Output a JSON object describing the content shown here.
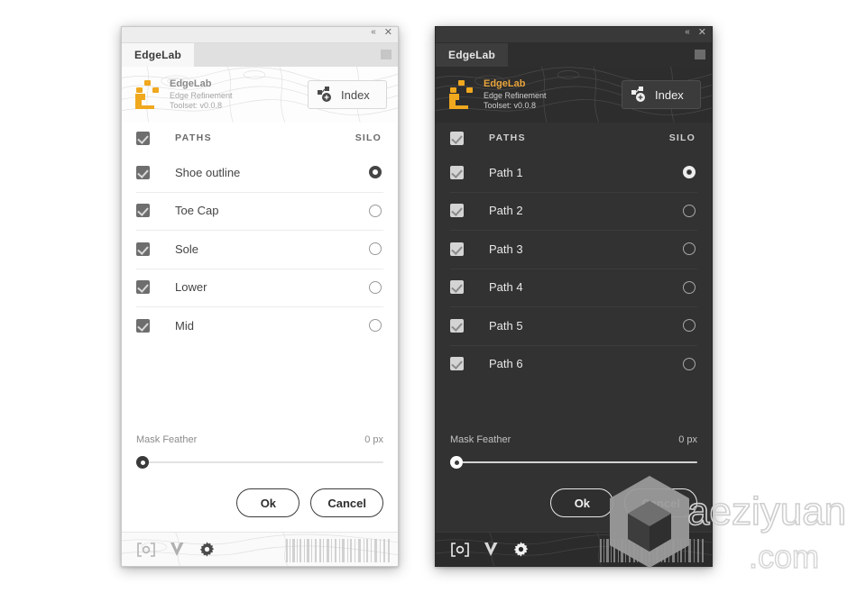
{
  "window": {
    "collapse_label": "«",
    "close_label": "✕"
  },
  "theme": {
    "accent_orange": "#f0a81e",
    "dark_bg": "#323232",
    "dark_panel_header": "#2d2d2d",
    "light_bg": "#ffffff",
    "light_header": "#ededed"
  },
  "panels": [
    {
      "variant": "light",
      "tab_label": "EdgeLab",
      "brand": {
        "title": "EdgeLab",
        "line1": "Edge Refinement",
        "line2": "Toolset: v0.0.8",
        "logo_icon": "edgelab-blocks-icon"
      },
      "index_button": {
        "label": "Index",
        "icon": "add-nodes-icon"
      },
      "list_header": {
        "checkbox_checked": true,
        "left_label": "PATHS",
        "right_label": "SILO"
      },
      "rows": [
        {
          "label": "Shoe outline",
          "checked": true,
          "silo": true
        },
        {
          "label": "Toe Cap",
          "checked": true,
          "silo": false
        },
        {
          "label": "Sole",
          "checked": true,
          "silo": false
        },
        {
          "label": "Lower",
          "checked": true,
          "silo": false
        },
        {
          "label": "Mid",
          "checked": true,
          "silo": false
        }
      ],
      "slider": {
        "label": "Mask Feather",
        "value_text": "0 px",
        "percent": 0
      },
      "buttons": {
        "ok": "Ok",
        "cancel": "Cancel"
      },
      "footer_icons": [
        "bracket-circle-icon",
        "v-check-icon",
        "gear-icon"
      ]
    },
    {
      "variant": "dark",
      "tab_label": "EdgeLab",
      "brand": {
        "title": "EdgeLab",
        "line1": "Edge Refinement",
        "line2": "Toolset: v0.0.8",
        "logo_icon": "edgelab-blocks-icon"
      },
      "index_button": {
        "label": "Index",
        "icon": "add-nodes-icon"
      },
      "list_header": {
        "checkbox_checked": true,
        "left_label": "PATHS",
        "right_label": "SILO"
      },
      "rows": [
        {
          "label": "Path 1",
          "checked": true,
          "silo": true
        },
        {
          "label": "Path 2",
          "checked": true,
          "silo": false
        },
        {
          "label": "Path 3",
          "checked": true,
          "silo": false
        },
        {
          "label": "Path 4",
          "checked": true,
          "silo": false
        },
        {
          "label": "Path 5",
          "checked": true,
          "silo": false
        },
        {
          "label": "Path 6",
          "checked": true,
          "silo": false
        }
      ],
      "slider": {
        "label": "Mask Feather",
        "value_text": "0 px",
        "percent": 0
      },
      "buttons": {
        "ok": "Ok",
        "cancel": "Cancel"
      },
      "footer_icons": [
        "bracket-circle-icon",
        "v-check-icon",
        "gear-icon"
      ]
    }
  ],
  "watermark": {
    "name": "aeziyuan",
    "domain": ".com",
    "logo_icon": "cube-logo-icon"
  }
}
